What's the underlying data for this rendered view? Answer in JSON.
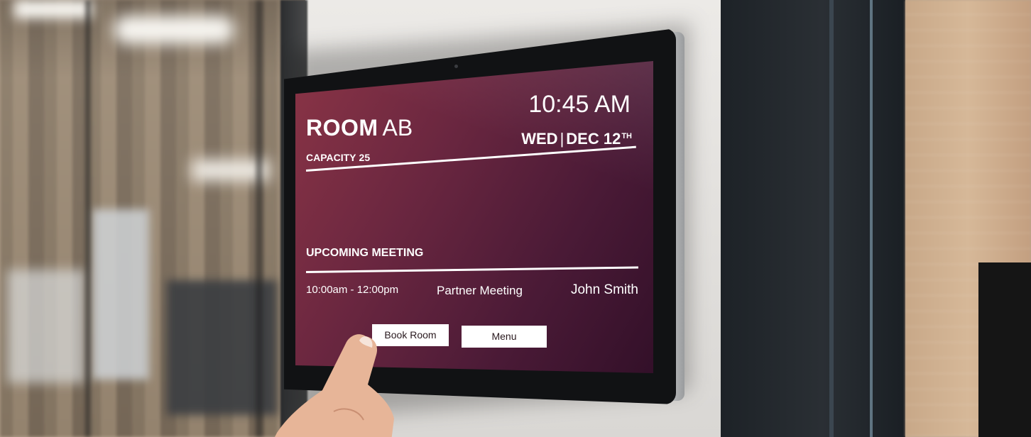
{
  "room": {
    "word": "ROOM",
    "id": "AB",
    "capacity_label": "CAPACITY",
    "capacity_value": "25"
  },
  "clock": {
    "time": "10:45 AM",
    "day": "WED",
    "separator": "|",
    "date": "DEC 12",
    "date_suffix": "TH"
  },
  "upcoming": {
    "label": "UPCOMING MEETING",
    "meeting": {
      "time": "10:00am - 12:00pm",
      "title": "Partner Meeting",
      "host": "John Smith"
    }
  },
  "actions": {
    "book_room": "Book Room",
    "menu": "Menu"
  },
  "colors": {
    "screen_gradient_start": "#8a3446",
    "screen_gradient_end": "#331029",
    "button_bg": "#ffffff",
    "text": "#ffffff"
  }
}
